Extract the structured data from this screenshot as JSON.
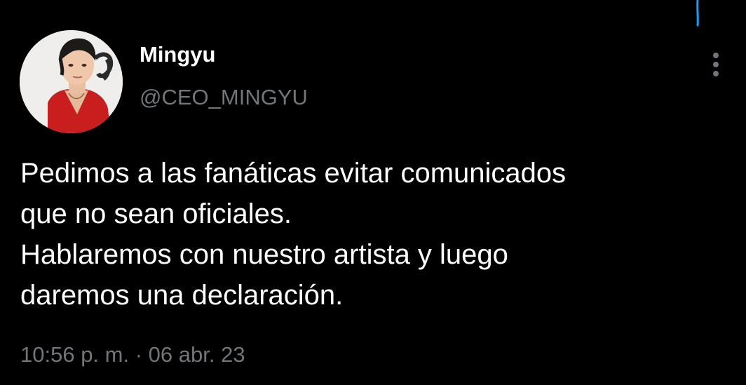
{
  "colors": {
    "background": "#000000",
    "text_primary": "#ffffff",
    "text_secondary": "#71767b",
    "accent": "#1d9bf0"
  },
  "author": {
    "display_name": "Mingyu",
    "handle": "@CEO_MINGYU",
    "avatar_icon": "profile-photo"
  },
  "menu": {
    "icon": "more-vertical-icon"
  },
  "tweet": {
    "lines": [
      "Pedimos a las fanáticas evitar comunicados",
      "que no sean oficiales.",
      "Hablaremos con nuestro artista y luego",
      "daremos una declaración."
    ],
    "time": "10:56 p. m.",
    "separator": "·",
    "date": "06 abr. 23"
  }
}
